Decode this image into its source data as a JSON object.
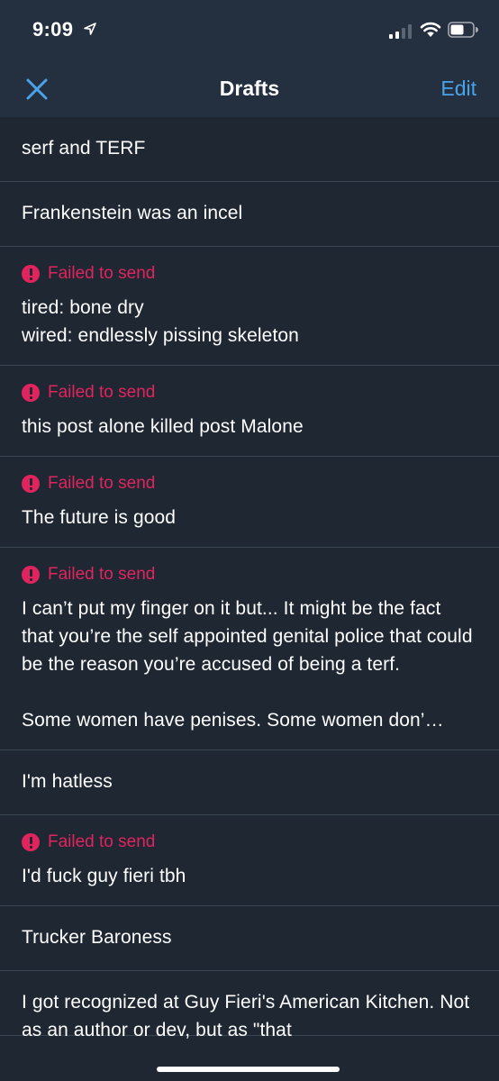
{
  "status_bar": {
    "time": "9:09",
    "location_icon": "location-arrow-icon",
    "signal_icon": "cellular-signal-icon",
    "wifi_icon": "wifi-icon",
    "battery_icon": "battery-icon"
  },
  "nav": {
    "close_icon": "close-icon",
    "title": "Drafts",
    "edit_label": "Edit"
  },
  "colors": {
    "background": "#1f2733",
    "bar": "#243040",
    "accent": "#4aa3e8",
    "error": "#e0245e"
  },
  "drafts": [
    {
      "failed": false,
      "text": "serf and TERF"
    },
    {
      "failed": false,
      "text": "Frankenstein was an incel"
    },
    {
      "failed": true,
      "status": "Failed to send",
      "text": "tired: bone dry\nwired: endlessly pissing skeleton"
    },
    {
      "failed": true,
      "status": "Failed to send",
      "text": "this post alone killed post Malone"
    },
    {
      "failed": true,
      "status": "Failed to send",
      "text": "The future is good"
    },
    {
      "failed": true,
      "status": "Failed to send",
      "text": "I can’t put my finger on it but... It might be the fact that you’re the self appointed genital police that could be the reason you’re accused of being a terf.\n\nSome women have penises. Some women don’…"
    },
    {
      "failed": false,
      "text": "I'm hatless"
    },
    {
      "failed": true,
      "status": "Failed to send",
      "text": "I'd fuck guy fieri tbh"
    },
    {
      "failed": false,
      "text": "Trucker Baroness"
    },
    {
      "failed": false,
      "text": "I got recognized at Guy Fieri's American Kitchen. Not as an author or dev, but as \"that"
    }
  ]
}
